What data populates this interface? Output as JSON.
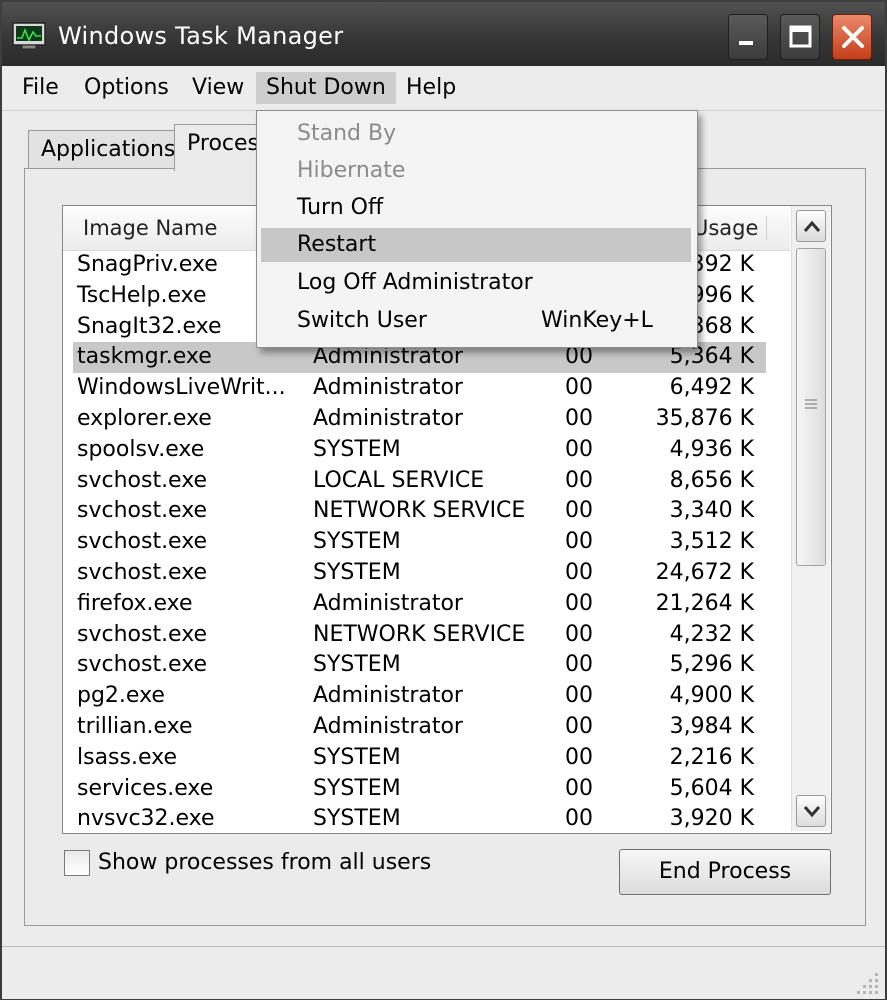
{
  "window": {
    "title": "Windows Task Manager"
  },
  "menubar": [
    "File",
    "Options",
    "View",
    "Shut Down",
    "Help"
  ],
  "tabs": [
    "Applications",
    "Proces"
  ],
  "table": {
    "headers": {
      "name": "Image Name",
      "mem": "Usage"
    },
    "rows": [
      [
        "SnagPriv.exe",
        "",
        "",
        "392 K"
      ],
      [
        "TscHelp.exe",
        "",
        "",
        "996 K"
      ],
      [
        "SnagIt32.exe",
        "",
        "",
        "368 K"
      ],
      [
        "taskmgr.exe",
        "Administrator",
        "00",
        "5,364 K"
      ],
      [
        "WindowsLiveWrit...",
        "Administrator",
        "00",
        "6,492 K"
      ],
      [
        "explorer.exe",
        "Administrator",
        "00",
        "35,876 K"
      ],
      [
        "spoolsv.exe",
        "SYSTEM",
        "00",
        "4,936 K"
      ],
      [
        "svchost.exe",
        "LOCAL SERVICE",
        "00",
        "8,656 K"
      ],
      [
        "svchost.exe",
        "NETWORK SERVICE",
        "00",
        "3,340 K"
      ],
      [
        "svchost.exe",
        "SYSTEM",
        "00",
        "3,512 K"
      ],
      [
        "svchost.exe",
        "SYSTEM",
        "00",
        "24,672 K"
      ],
      [
        "firefox.exe",
        "Administrator",
        "00",
        "21,264 K"
      ],
      [
        "svchost.exe",
        "NETWORK SERVICE",
        "00",
        "4,232 K"
      ],
      [
        "svchost.exe",
        "SYSTEM",
        "00",
        "5,296 K"
      ],
      [
        "pg2.exe",
        "Administrator",
        "00",
        "4,900 K"
      ],
      [
        "trillian.exe",
        "Administrator",
        "00",
        "3,984 K"
      ],
      [
        "lsass.exe",
        "SYSTEM",
        "00",
        "2,216 K"
      ],
      [
        "services.exe",
        "SYSTEM",
        "00",
        "5,604 K"
      ],
      [
        "nvsvc32.exe",
        "SYSTEM",
        "00",
        "3,920 K"
      ]
    ],
    "selected_index": 3
  },
  "dropdown": {
    "items": [
      {
        "label": "Stand By",
        "disabled": true
      },
      {
        "label": "Hibernate",
        "disabled": true
      },
      {
        "label": "Turn Off"
      },
      {
        "label": "Restart",
        "highlighted": true
      },
      {
        "label": "Log Off Administrator"
      },
      {
        "label": "Switch User",
        "shortcut": "WinKey+L"
      }
    ]
  },
  "footer": {
    "checkbox_label": "Show processes from all users",
    "end_process": "End Process"
  }
}
